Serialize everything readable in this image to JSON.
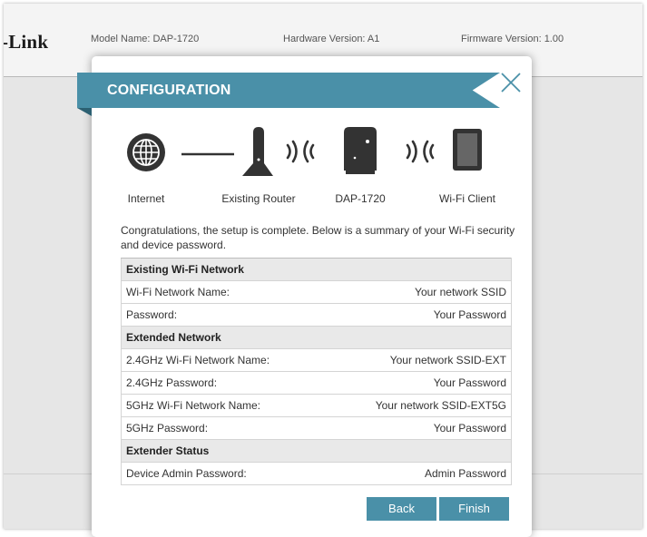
{
  "header": {
    "logo_text": "-Link",
    "model_name": "Model Name: DAP-1720",
    "hardware_version": "Hardware Version: A1",
    "firmware_version": "Firmware Version: 1.00"
  },
  "modal": {
    "title": "CONFIGURATION",
    "diagram": {
      "labels": [
        "Internet",
        "Existing Router",
        "DAP-1720",
        "Wi-Fi Client"
      ]
    },
    "summary_line1": "Congratulations, the setup is complete. Below is a summary of your Wi-Fi security",
    "summary_line2": "and device password.",
    "sections": [
      {
        "heading": "Existing Wi-Fi Network",
        "rows": [
          {
            "label": "Wi-Fi Network Name:",
            "value": "Your network SSID"
          },
          {
            "label": "Password:",
            "value": "Your Password"
          }
        ]
      },
      {
        "heading": "Extended Network",
        "rows": [
          {
            "label": "2.4GHz Wi-Fi Network Name:",
            "value": "Your network SSID-EXT"
          },
          {
            "label": "2.4GHz Password:",
            "value": "Your Password"
          },
          {
            "label": "5GHz Wi-Fi Network Name:",
            "value": "Your network SSID-EXT5G"
          },
          {
            "label": "5GHz Password:",
            "value": "Your Password"
          }
        ]
      },
      {
        "heading": "Extender Status",
        "rows": [
          {
            "label": "Device Admin Password:",
            "value": "Admin Password"
          }
        ]
      }
    ],
    "buttons": {
      "back": "Back",
      "finish": "Finish"
    }
  },
  "colors": {
    "accent": "#4a90a8",
    "icon": "#333333"
  }
}
